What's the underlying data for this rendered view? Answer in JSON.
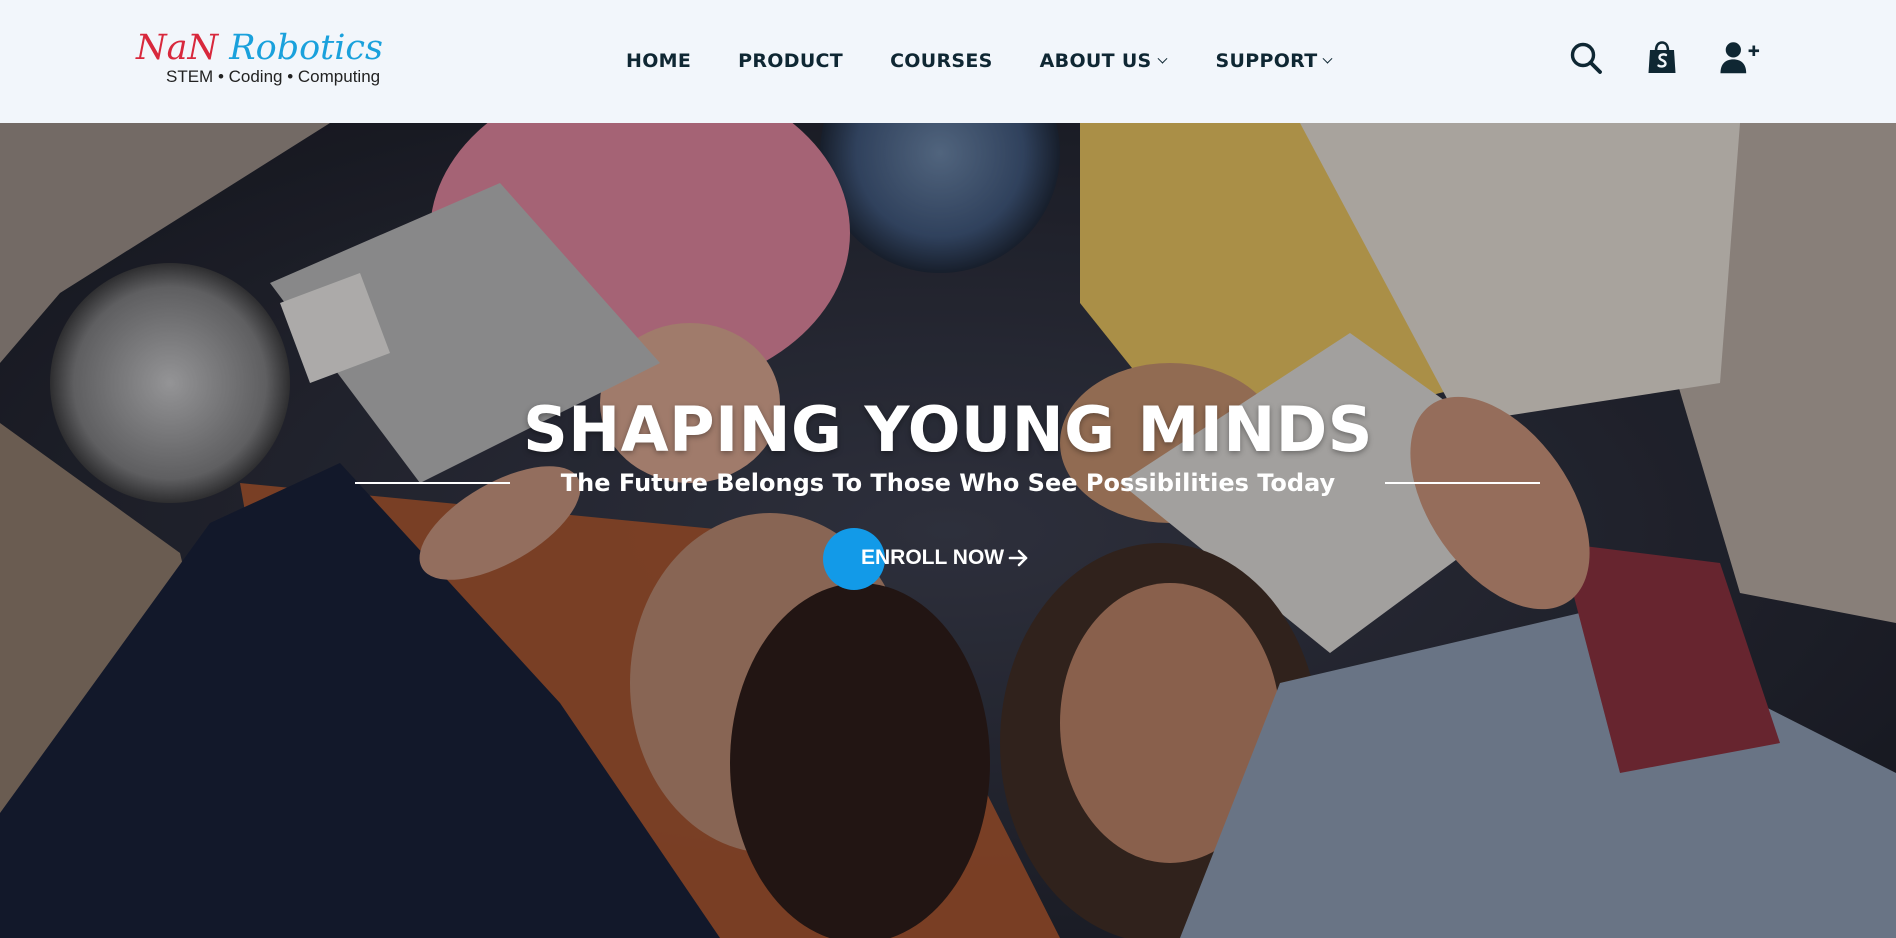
{
  "brand": {
    "name_part1": "NaN",
    "name_part2": "Robotics",
    "tagline": "STEM • Coding • Computing",
    "colors": {
      "red": "#d8283c",
      "blue": "#1aa1dc"
    }
  },
  "nav": {
    "items": [
      {
        "label": "HOME",
        "has_dropdown": false
      },
      {
        "label": "PRODUCT",
        "has_dropdown": false
      },
      {
        "label": "COURSES",
        "has_dropdown": false
      },
      {
        "label": "ABOUT US",
        "has_dropdown": true
      },
      {
        "label": "SUPPORT",
        "has_dropdown": true
      }
    ]
  },
  "header_icons": [
    "search-icon",
    "shopping-bag-icon",
    "add-user-icon"
  ],
  "hero": {
    "title": "SHAPING YOUNG MINDS",
    "subtitle": "The Future Belongs To Those Who See Possibilities Today",
    "cta_label": "ENROLL NOW",
    "cta_icon": "arrow-right-icon",
    "accent_color": "#129ae8"
  }
}
